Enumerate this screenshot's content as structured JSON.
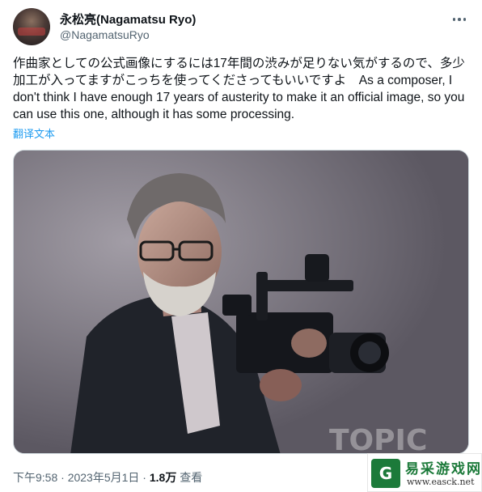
{
  "author": {
    "display_name": "永松亮(Nagamatsu Ryo)",
    "handle": "@NagamatsuRyo",
    "avatar_icon": "user-avatar"
  },
  "header": {
    "more_icon": "more-horizontal-icon"
  },
  "tweet": {
    "text": "作曲家としての公式画像にするには17年間の渋みが足りない気がするので、多少加工が入ってますがこっちを使ってくださってもいいですよ　As a composer, I don't think I have enough 17 years of austerity to make it an official image, so you can use this one, although it has some processing.",
    "translate_label": "翻译文本"
  },
  "media": {
    "description_icon": "photo-image"
  },
  "footer": {
    "time": "下午9:58",
    "separator": " · ",
    "date": "2023年5月1日",
    "views_count": "1.8万",
    "views_label": "查看"
  },
  "watermark": {
    "logo_text": "G",
    "title": "易采游戏网",
    "url": "www.easck.net"
  },
  "colors": {
    "link": "#1d9bf0",
    "secondary_text": "#536471",
    "primary_text": "#0f1419",
    "watermark_green": "#1c7a3a"
  }
}
